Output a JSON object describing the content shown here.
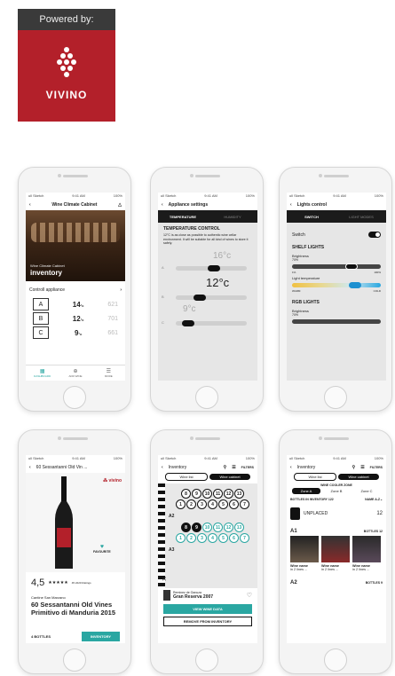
{
  "badge": {
    "powered_by": "Powered by:",
    "brand": "VIVINO"
  },
  "phone1": {
    "title": "Wine Climate Cabinet",
    "hero_subtitle": "Wine Climate Cabinet",
    "hero_title": "inventory",
    "control_label": "Controll appliance",
    "zones": [
      {
        "letter": "A",
        "temp": "14",
        "unit": "°c",
        "bottles": "621"
      },
      {
        "letter": "B",
        "temp": "12",
        "unit": "°c",
        "bottles": "701"
      },
      {
        "letter": "C",
        "temp": "9",
        "unit": "°c",
        "bottles": "661"
      }
    ],
    "tabs": [
      "DASHBOARD",
      "ADD WINE",
      "MORE"
    ]
  },
  "phone2": {
    "title": "Appliance settings",
    "tab_left": "TEMPERATURE",
    "tab_right": "HUMIDITY",
    "heading": "TEMPERATURE CONTROL",
    "desc": "12°C is as close as possible to authentic wine cellar environment. It will be suitable for all kind of wines to store it safely.",
    "zone_a_temp": "16°c",
    "zone_b_temp": "12°c",
    "zone_c_temp": "9°c",
    "zone_letters": [
      "A",
      "B",
      "C"
    ],
    "levels": [
      0.55,
      0.3,
      0.1
    ]
  },
  "phone3": {
    "title": "Lights control",
    "tab_left": "SWITCH",
    "tab_right": "LIGHT MODES",
    "switch_label": "Switch",
    "shelf_heading": "SHELF LIGHTS",
    "brightness_label": "Brightness",
    "brightness_value": "70%",
    "brightness_min": "1%",
    "brightness_max": "100%",
    "temp_label": "Light temperature",
    "temp_min": "WARM",
    "temp_max": "COLD",
    "rgb_heading": "RGB LIGHTS",
    "rgb_brightness_label": "Brightness",
    "rgb_brightness_value": "70%"
  },
  "phone4": {
    "title": "60 Sessantanni Old Vin ...",
    "brand": "vivino",
    "favourite": "FAVOURITE",
    "rating": "4,5",
    "stars": "★★★★★",
    "ratings_count": "45 2220 Ratings",
    "winery": "Cantine San Marzano",
    "wine_name": "60 Sessantanni Old Vines Primitivo di Manduria 2015",
    "bottles": "4 BOTTLES",
    "inventory_btn": "INVENTORY"
  },
  "phone5": {
    "title": "Inventory",
    "filters": "FILTERS",
    "seg_left": "Wine list",
    "seg_right": "Wine cabinet",
    "row1_top": [
      "8",
      "9",
      "10",
      "11",
      "12",
      "13"
    ],
    "row1_bottom": [
      "1",
      "2",
      "3",
      "4",
      "5",
      "6",
      "7"
    ],
    "row_label_a2": "A2",
    "row2_top": [
      "8",
      "9",
      "10",
      "11",
      "12",
      "13"
    ],
    "row2_bottom": [
      "1",
      "2",
      "3",
      "4",
      "5",
      "6",
      "7"
    ],
    "row_label_a3": "A3",
    "winery": "Reminez de Ganuza",
    "wine": "Gran Reserva 2007",
    "view_btn": "VIEW WINE DATA",
    "remove_btn": "REMOVE FROM INVENTORY"
  },
  "phone6": {
    "title": "Inventory",
    "filters": "FILTERS",
    "seg_left": "Wine list",
    "seg_right": "Wine cabinet",
    "zone_heading": "WINE COOLER ZONE",
    "zones": [
      "Zone A",
      "Zone B",
      "Zone C"
    ],
    "bottles_in_inventory": "BOTTLES IN INVENTORY 122",
    "sort": "NAME A-Z",
    "unplaced": "UNPLACED",
    "unplaced_count": "12",
    "a1": "A1",
    "a1_bottles": "BOTTLES 12",
    "wine_items": [
      {
        "name": "Wine name",
        "detail": "in 2 lines ..."
      },
      {
        "name": "Wine name",
        "detail": "in 2 lines ..."
      },
      {
        "name": "Wine name",
        "detail": "in 2 lines ..."
      }
    ],
    "a2": "A2",
    "a2_bottles": "BOTTLES 9"
  },
  "colors": {
    "badge_red": "#b3202a",
    "badge_dark": "#3a3a3a",
    "teal": "#2aa7a2",
    "dark": "#1b1b1b"
  }
}
